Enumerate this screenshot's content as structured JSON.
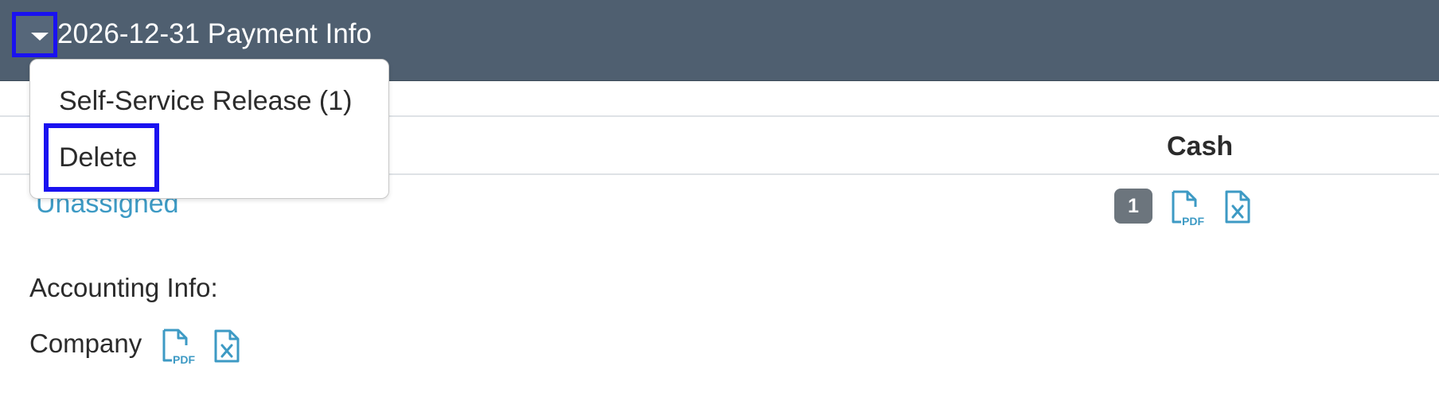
{
  "header": {
    "title": "2026-12-31 Payment Info",
    "background_color": "#4f5f70",
    "toggle_icon": "caret-down-icon"
  },
  "dropdown_menu": {
    "items": [
      {
        "label": "Self-Service Release (1)"
      },
      {
        "label": "Delete"
      }
    ],
    "highlight_color": "#1a12f0"
  },
  "table": {
    "columns": [
      "Cash"
    ],
    "rows": [
      {
        "name": "Unassigned",
        "cash_count": "1",
        "icons": [
          "file-pdf-icon",
          "file-excel-icon"
        ]
      }
    ]
  },
  "accounting": {
    "label": "Accounting Info:",
    "company_label": "Company",
    "icons": [
      "file-pdf-icon",
      "file-excel-icon"
    ]
  },
  "icons": {
    "pdf_text": "PDF",
    "excel_text": "x",
    "color": "#3d9ac4"
  }
}
